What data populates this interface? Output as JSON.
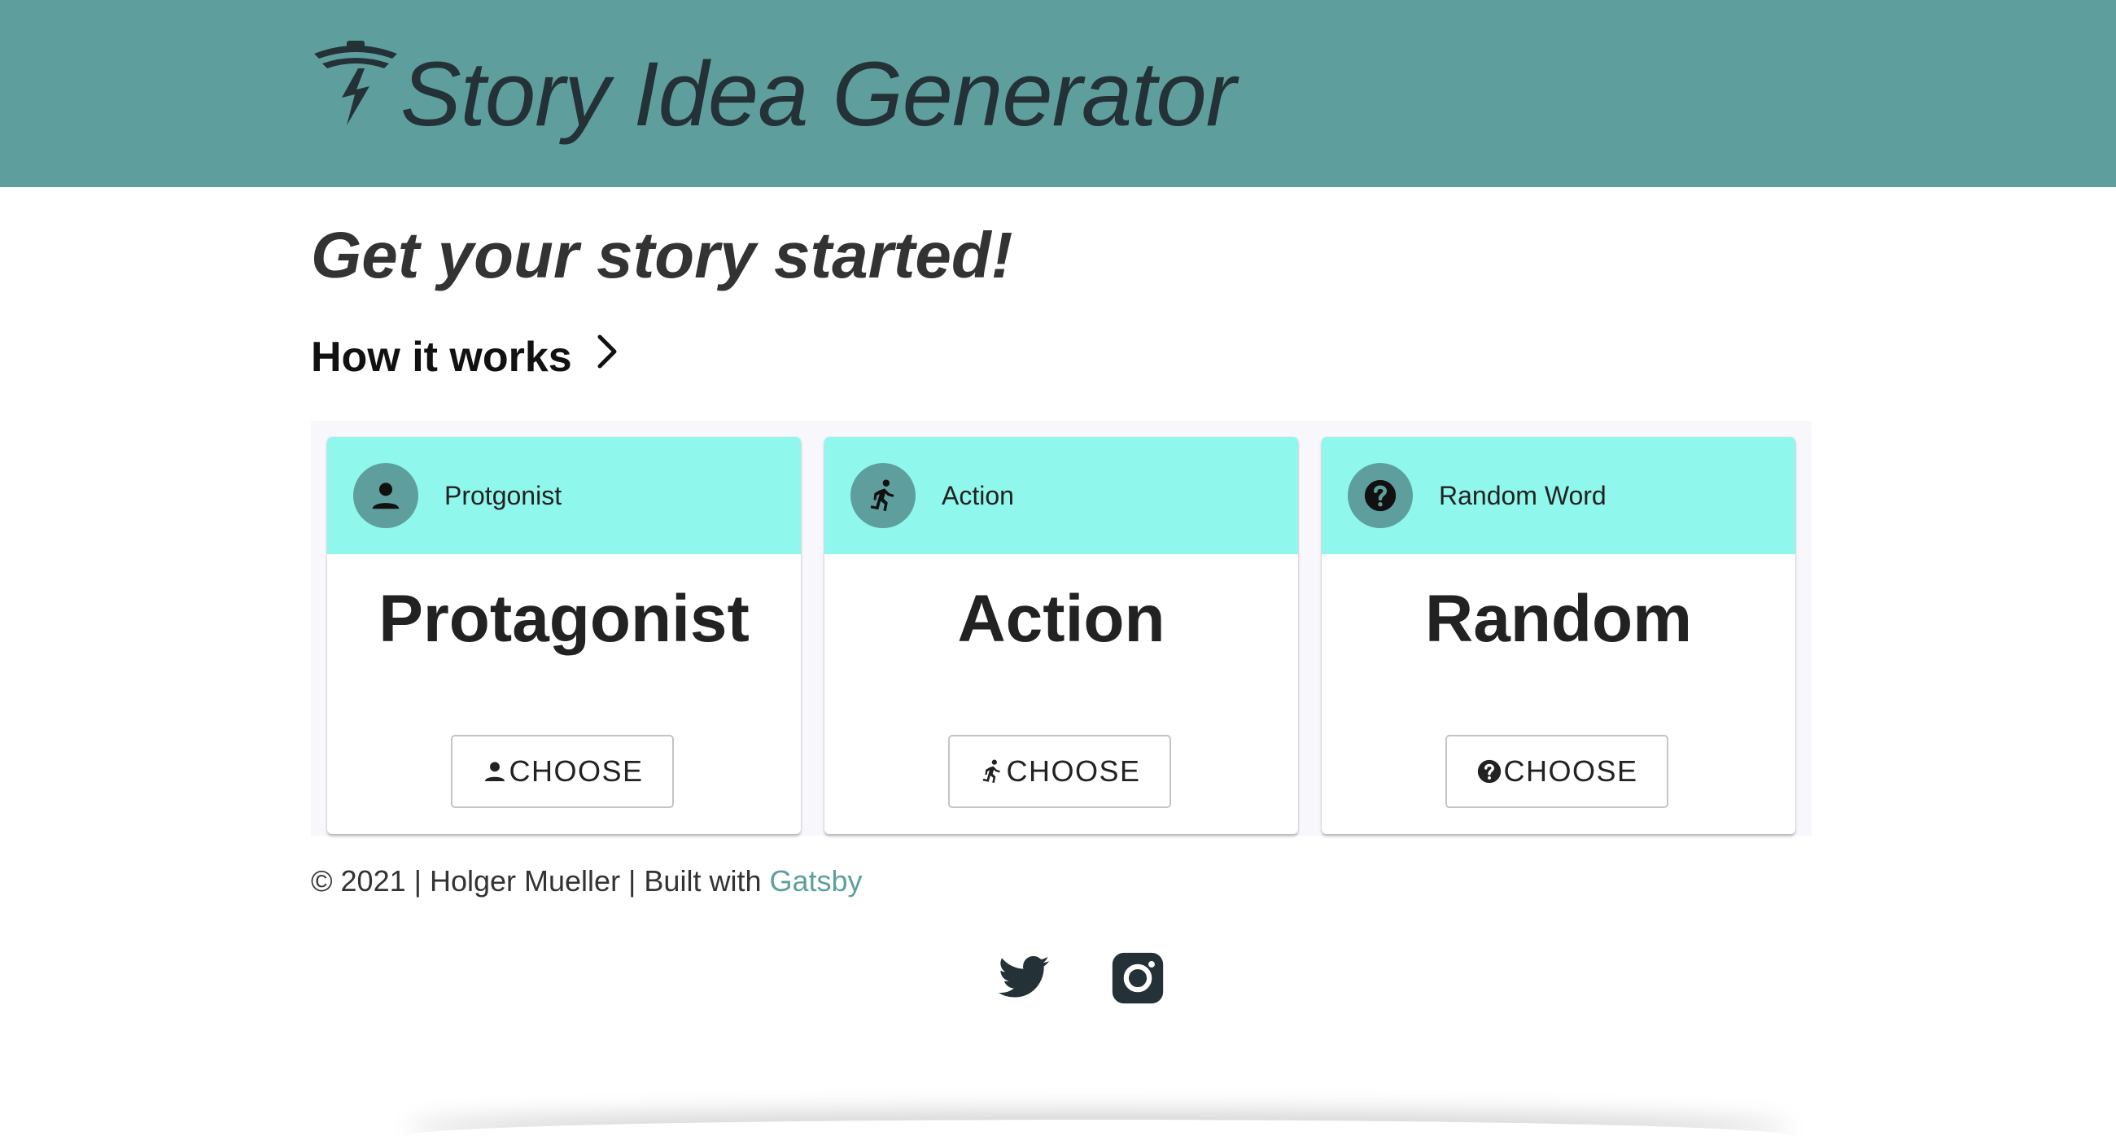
{
  "header": {
    "title": "Story Idea Generator",
    "logo_icon": "lightning-lantern-logo-icon"
  },
  "main": {
    "headline": "Get your story started!",
    "how_it_works": {
      "label": "How it works",
      "icon": "chevron-right-icon"
    }
  },
  "cards": [
    {
      "head_label": "Protgonist",
      "title": "Protagonist",
      "button_label": "CHOOSE",
      "icon": "person-icon"
    },
    {
      "head_label": "Action",
      "title": "Action",
      "button_label": "CHOOSE",
      "icon": "running-person-icon"
    },
    {
      "head_label": "Random Word",
      "title": "Random",
      "button_label": "CHOOSE",
      "icon": "help-circle-icon"
    }
  ],
  "footer": {
    "prefix": "© 2021 | Holger Mueller | Built with",
    "link": "Gatsby"
  },
  "social": [
    {
      "icon": "twitter-icon"
    },
    {
      "icon": "instagram-icon"
    }
  ],
  "colors": {
    "header_bg": "#5e9f9d",
    "card_head_bg": "#90f7ec",
    "accent": "#5e9f9d",
    "title_text": "#243238"
  }
}
